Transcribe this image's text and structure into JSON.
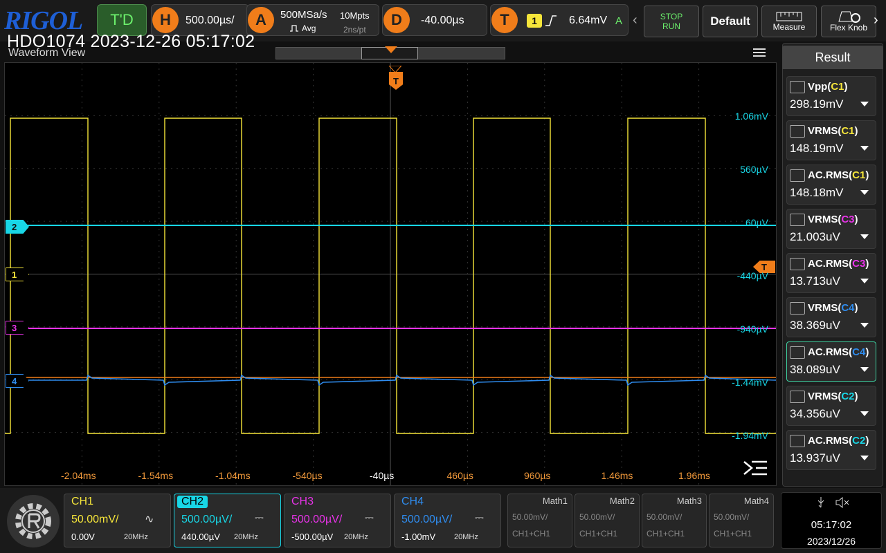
{
  "brand": "RIGOL",
  "overlay_title": "HDO1074 2023-12-26 05:17:02",
  "topbar": {
    "trigger_mode": "T'D",
    "horizontal": {
      "badge": "H",
      "timebase": "500.00µs/"
    },
    "acquire": {
      "badge": "A",
      "sample_rate": "500MSa/s",
      "memory": "10Mpts",
      "mode": "Avg",
      "resolution": "2ns/pt"
    },
    "delay": {
      "badge": "D",
      "value": "-40.00µs"
    },
    "trigger": {
      "badge": "T",
      "source": "1",
      "level": "6.64mV",
      "type": "A"
    },
    "stop_run": {
      "stop": "STOP",
      "run": "RUN"
    },
    "default_label": "Default",
    "measure_label": "Measure",
    "flex_knob_label": "Flex Knob"
  },
  "waveform_view": {
    "title": "Waveform View",
    "trigger_marker": "T",
    "y_labels": [
      "1.06mV",
      "560µV",
      "60µV",
      "-440µV",
      "-940µV",
      "-1.44mV",
      "-1.94mV"
    ],
    "x_labels": [
      "-2.04ms",
      "-1.54ms",
      "-1.04ms",
      "-540µs",
      "-40µs",
      "460µs",
      "960µs",
      "1.46ms",
      "1.96ms"
    ],
    "channel_markers": [
      "2",
      "1",
      "3",
      "4"
    ],
    "right_trigger_marker": "T"
  },
  "result_panel": {
    "title": "Result",
    "items": [
      {
        "name": "Vpp",
        "src": "C1",
        "value": "298.19mV",
        "color": "#f5e53a"
      },
      {
        "name": "VRMS",
        "src": "C1",
        "value": "148.19mV",
        "color": "#f5e53a"
      },
      {
        "name": "AC.RMS",
        "src": "C1",
        "value": "148.18mV",
        "color": "#f5e53a"
      },
      {
        "name": "VRMS",
        "src": "C3",
        "value": "21.003uV",
        "color": "#e833e8"
      },
      {
        "name": "AC.RMS",
        "src": "C3",
        "value": "13.713uV",
        "color": "#e833e8"
      },
      {
        "name": "VRMS",
        "src": "C4",
        "value": "38.369uV",
        "color": "#2f8df0"
      },
      {
        "name": "AC.RMS",
        "src": "C4",
        "value": "38.089uV",
        "color": "#2f8df0"
      },
      {
        "name": "VRMS",
        "src": "C2",
        "value": "34.356uV",
        "color": "#18d6e6"
      },
      {
        "name": "AC.RMS",
        "src": "C2",
        "value": "13.937uV",
        "color": "#18d6e6"
      }
    ]
  },
  "channels": [
    {
      "name": "CH1",
      "scale": "50.00mV/",
      "offset": "0.00V",
      "bw": "20MHz",
      "color": "#f5e53a",
      "coupling": "~"
    },
    {
      "name": "CH2",
      "scale": "500.00µV/",
      "offset": "440.00µV",
      "bw": "20MHz",
      "color": "#18d6e6",
      "coupling": "DC"
    },
    {
      "name": "CH3",
      "scale": "500.00µV/",
      "offset": "-500.00µV",
      "bw": "20MHz",
      "color": "#e833e8",
      "coupling": "DC"
    },
    {
      "name": "CH4",
      "scale": "500.00µV/",
      "offset": "-1.00mV",
      "bw": "20MHz",
      "color": "#2f8df0",
      "coupling": "DC"
    }
  ],
  "math": [
    {
      "name": "Math1",
      "scale": "50.00mV/",
      "source": "CH1+CH1"
    },
    {
      "name": "Math2",
      "scale": "50.00mV/",
      "source": "CH1+CH1"
    },
    {
      "name": "Math3",
      "scale": "50.00mV/",
      "source": "CH1+CH1"
    },
    {
      "name": "Math4",
      "scale": "50.00mV/",
      "source": "CH1+CH1"
    }
  ],
  "status": {
    "time": "05:17:02",
    "date": "2023/12/26"
  }
}
